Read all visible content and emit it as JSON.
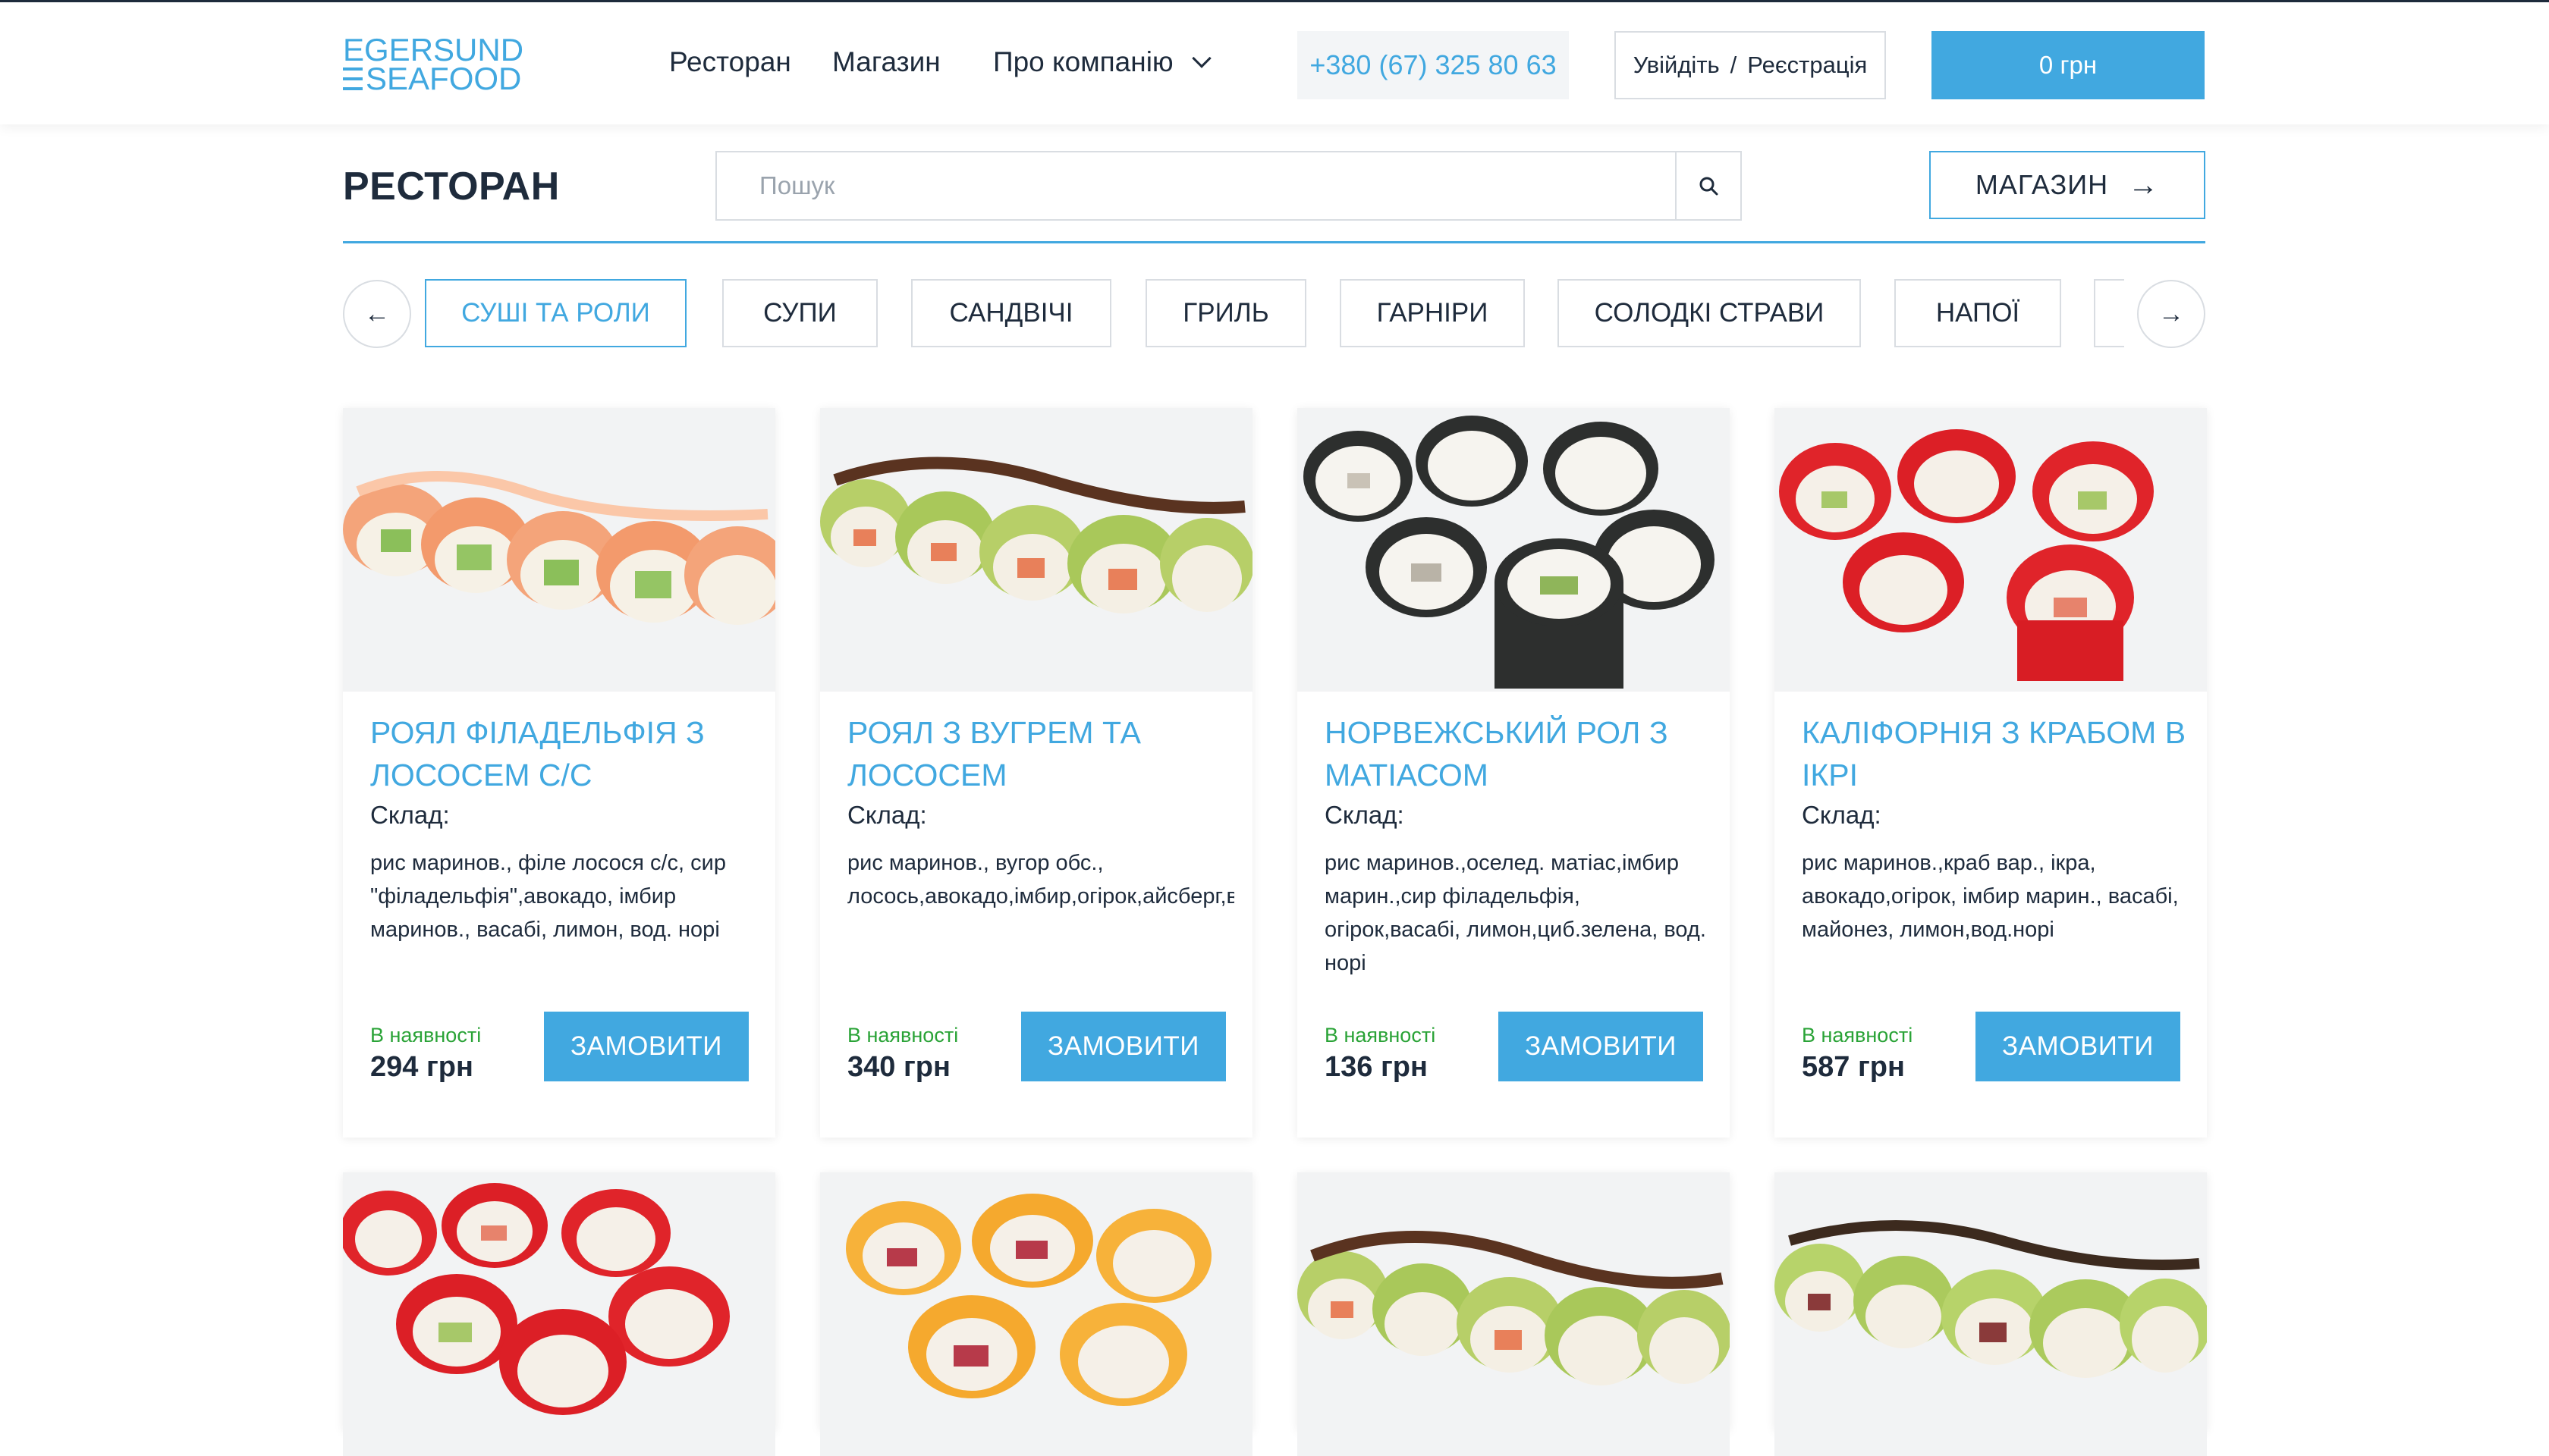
{
  "header": {
    "logo_line1": "EGERSUND",
    "logo_line2": "SEAFOOD",
    "nav": {
      "restaurant": "Ресторан",
      "shop": "Магазин",
      "about": "Про компанію"
    },
    "phone": "+380 (67) 325 80 63",
    "login": "Увійдіть",
    "login_sep": "/",
    "register": "Реєстрація",
    "cart": "0 грн"
  },
  "page": {
    "title": "РЕСТОРАН",
    "search_placeholder": "Пошук",
    "shop_button": "МАГАЗИН",
    "shop_arrow": "→"
  },
  "categories": {
    "prev": "←",
    "next": "→",
    "items": [
      "СУШІ ТА РОЛИ",
      "СУПИ",
      "САНДВІЧІ",
      "ГРИЛЬ",
      "ГАРНІРИ",
      "СОЛОДКІ СТРАВИ",
      "НАПОЇ"
    ],
    "active_index": 0
  },
  "products": [
    {
      "title": "РОЯЛ ФІЛАДЕЛЬФІЯ З ЛОСОСЕМ С/С",
      "composition_label": "Склад:",
      "composition": "рис маринов., філе лосося с/с, сир \"філадельфія\",авокадо, імбир маринов., васабі, лимон, вод. норі",
      "stock": "В наявності",
      "price": "294 грн",
      "order": "ЗАМОВИТИ",
      "image": "salmon-roll"
    },
    {
      "title": "РОЯЛ З ВУГРЕМ ТА ЛОСОСЕМ",
      "composition_label": "Склад:",
      "composition": "рис маринов., вугор обс., лосось,авокадо,імбир,огірок,айсберг,вод.норі",
      "stock": "В наявності",
      "price": "340 грн",
      "order": "ЗАМОВИТИ",
      "image": "eel-avocado-roll"
    },
    {
      "title": "НОРВЕЖСЬКИЙ РОЛ З МАТІАСОМ",
      "composition_label": "Склад:",
      "composition": "рис маринов.,оселед. матіас,імбир марин.,сир філадельфія, огірок,васабі, лимон,циб.зелена, вод. норі",
      "stock": "В наявності",
      "price": "136 грн",
      "order": "ЗАМОВИТИ",
      "image": "nori-roll"
    },
    {
      "title": "КАЛІФОРНІЯ З КРАБОМ В ІКРІ",
      "composition_label": "Склад:",
      "composition": "рис маринов.,краб вар., ікра, авокадо,огірок, імбир марин., васабі, майонез, лимон,вод.норі",
      "stock": "В наявності",
      "price": "587 грн",
      "order": "ЗАМОВИТИ",
      "image": "red-caviar-roll"
    },
    {
      "image": "red-caviar-roll"
    },
    {
      "image": "orange-roll"
    },
    {
      "image": "eel-avocado-roll"
    },
    {
      "image": "avocado-roll"
    }
  ],
  "colors": {
    "accent": "#41a8e0",
    "text": "#1e2b3c",
    "stock": "#2aa337",
    "border": "#d9dde2"
  }
}
